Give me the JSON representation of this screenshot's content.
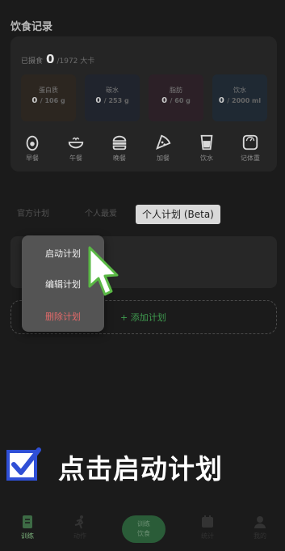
{
  "diet": {
    "title": "饮食记录",
    "intake_label": "已摄食",
    "intake_value": "0",
    "intake_target": "/1972 大卡",
    "macros": [
      {
        "name": "蛋白质",
        "value": "0",
        "unit": "/ 106 g",
        "color": "#2c2620"
      },
      {
        "name": "碳水",
        "value": "0",
        "unit": "/ 253 g",
        "color": "#20242d"
      },
      {
        "name": "脂肪",
        "value": "0",
        "unit": "/ 60 g",
        "color": "#2c2027"
      },
      {
        "name": "饮水",
        "value": "0",
        "unit": "/ 2000 ml",
        "color": "#1f2933"
      }
    ],
    "meals": [
      {
        "label": "早餐",
        "icon": "egg-icon"
      },
      {
        "label": "午餐",
        "icon": "bowl-icon"
      },
      {
        "label": "晚餐",
        "icon": "burger-icon"
      },
      {
        "label": "加餐",
        "icon": "pizza-icon"
      },
      {
        "label": "饮水",
        "icon": "cup-icon"
      },
      {
        "label": "记体重",
        "icon": "scale-icon"
      }
    ]
  },
  "tabs": [
    {
      "label": "官方计划",
      "active": false
    },
    {
      "label": "个人最爱",
      "active": false
    },
    {
      "label": "个人计划 (Beta)",
      "active": true
    }
  ],
  "add_plan": {
    "label": "+ 添加计划"
  },
  "context_menu": {
    "items": [
      {
        "label": "启动计划",
        "danger": false
      },
      {
        "label": "编辑计划",
        "danger": false
      },
      {
        "label": "删除计划",
        "danger": true
      }
    ]
  },
  "caption": {
    "text": "点击启动计划"
  },
  "bottom_nav": {
    "items": [
      {
        "label": "训练",
        "icon": "document-icon",
        "active": true
      },
      {
        "label": "动作",
        "icon": "running-icon",
        "active": false
      },
      {
        "label": "统计",
        "icon": "calendar-icon",
        "active": false
      },
      {
        "label": "我的",
        "icon": "person-icon",
        "active": false
      }
    ],
    "center": {
      "line1": "训练",
      "line2": "饮食"
    }
  },
  "colors": {
    "accent_green": "#3f9b4f",
    "danger": "#e46a6a",
    "checkbox_blue": "#2f4fd6"
  }
}
